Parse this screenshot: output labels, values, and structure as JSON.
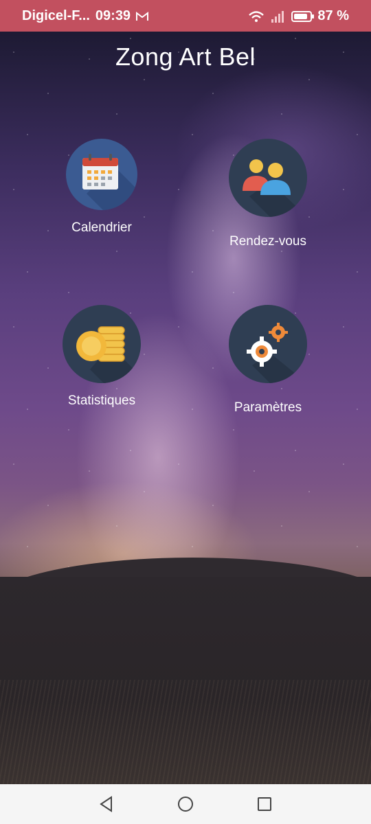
{
  "status_bar": {
    "carrier": "Digicel-F...",
    "time": "09:39",
    "mail_icon": "gmail-icon",
    "wifi_icon": "wifi-icon",
    "signal_icon": "signal-icon",
    "battery_percent": "87 %",
    "battery_level": 0.87,
    "background_color": "#c2505f"
  },
  "app": {
    "title": "Zong Art Bel"
  },
  "tiles": [
    {
      "label": "Calendrier",
      "icon": "calendar-icon"
    },
    {
      "label": "Rendez-vous",
      "icon": "users-icon"
    },
    {
      "label": "Statistiques",
      "icon": "coins-icon"
    },
    {
      "label": "Paramètres",
      "icon": "gears-icon"
    }
  ],
  "navbar": {
    "back": "back-triangle-icon",
    "home": "home-circle-icon",
    "recents": "recents-square-icon"
  }
}
